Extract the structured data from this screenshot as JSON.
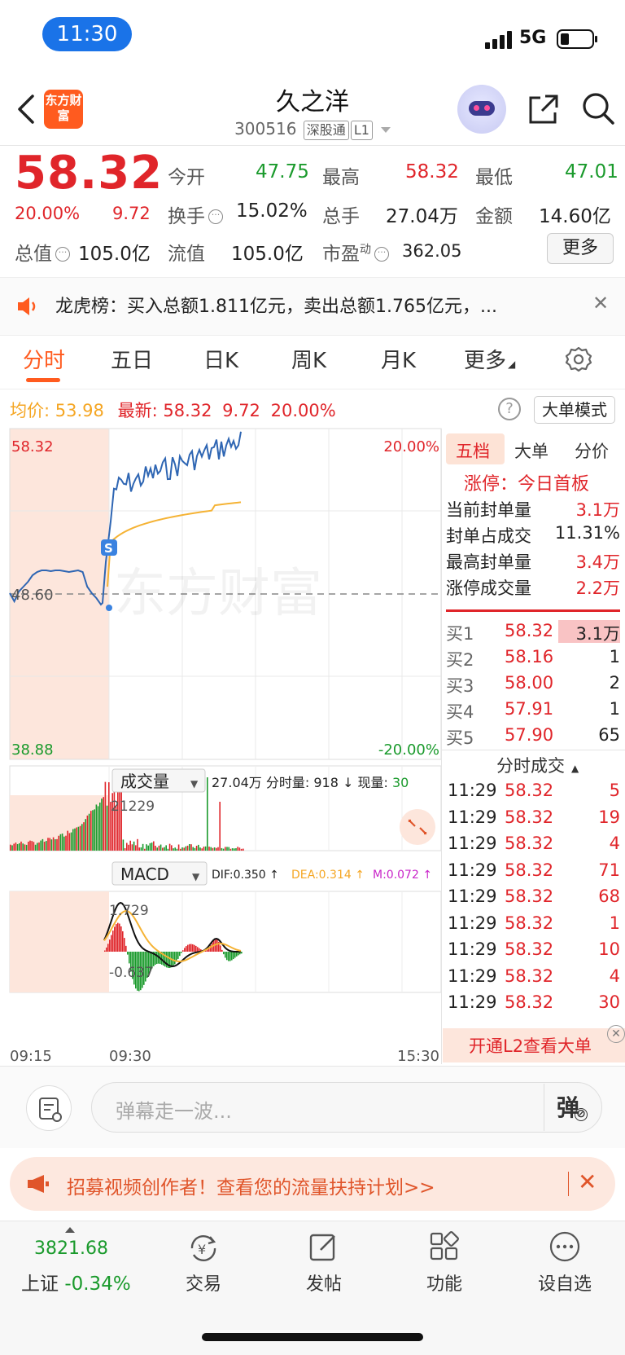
{
  "status_bar": {
    "time": "11:30",
    "network": "5G"
  },
  "header": {
    "logo_text": "东方财富",
    "stock_name": "久之洋",
    "stock_code": "300516",
    "connect_tag": "深股通",
    "level_tag": "L1"
  },
  "quote": {
    "price": "58.32",
    "change_pct": "20.00%",
    "change_amt": "9.72",
    "open_label": "今开",
    "open_value": "47.75",
    "high_label": "最高",
    "high_value": "58.32",
    "low_label": "最低",
    "low_value": "47.01",
    "turnover_label": "换手",
    "turnover_value": "15.02%",
    "volume_label": "总手",
    "volume_value": "27.04万",
    "amount_label": "金额",
    "amount_value": "14.60亿",
    "mktcap_label": "总值",
    "mktcap_value": "105.0亿",
    "float_label": "流值",
    "float_value": "105.0亿",
    "pe_label": "市盈",
    "pe_sup": "动",
    "pe_value": "362.05",
    "more_button": "更多"
  },
  "dragon_tiger": {
    "text": "龙虎榜：买入总额1.811亿元，卖出总额1.765亿元，..."
  },
  "tabs": [
    {
      "label": "分时"
    },
    {
      "label": "五日"
    },
    {
      "label": "日K"
    },
    {
      "label": "周K"
    },
    {
      "label": "月K"
    },
    {
      "label": "更多"
    }
  ],
  "intraday_info": {
    "avg_label": "均价:",
    "avg_value": "53.98",
    "latest_label": "最新:",
    "latest_value": "58.32",
    "latest_chg": "9.72",
    "latest_pct": "20.00%",
    "big_order_button": "大单模式"
  },
  "price_chart": {
    "y_top_label": "58.32",
    "y_mid_label": "48.60",
    "y_bottom_label": "38.88",
    "pct_top_label": "20.00%",
    "pct_bottom_label": "-20.00%",
    "watermark": "东方财富",
    "marker": "S",
    "colors": {
      "price": "#2f66b3",
      "avg": "#f5b335",
      "up": "#e0252a",
      "down": "#1a9a2c"
    }
  },
  "volume_panel": {
    "selector": "成交量",
    "summary": "27.04万 分时量: 918 ↓ 现量: ",
    "current_volume": "30",
    "max_label": "21229"
  },
  "macd_panel": {
    "selector": "MACD",
    "dif": "DIF:0.350 ↑",
    "dea": "DEA:0.314 ↑",
    "m": "M:0.072 ↑",
    "max_label": "1.729",
    "min_label": "-0.637"
  },
  "time_axis": {
    "t1": "09:15",
    "t2": "09:30",
    "t3": "15:30"
  },
  "side_panel": {
    "tabs": [
      "五档",
      "大单",
      "分价"
    ],
    "limit_title": "涨停：今日首板",
    "stats": [
      {
        "label": "当前封单量",
        "value": "3.1万"
      },
      {
        "label": "封单占成交",
        "value": "11.31%"
      },
      {
        "label": "最高封单量",
        "value": "3.4万"
      },
      {
        "label": "涨停成交量",
        "value": "2.2万"
      }
    ],
    "bids": [
      {
        "label": "买1",
        "price": "58.32",
        "volume": "3.1万"
      },
      {
        "label": "买2",
        "price": "58.16",
        "volume": "1"
      },
      {
        "label": "买3",
        "price": "58.00",
        "volume": "2"
      },
      {
        "label": "买4",
        "price": "57.91",
        "volume": "1"
      },
      {
        "label": "买5",
        "price": "57.90",
        "volume": "65"
      }
    ],
    "trades_title": "分时成交",
    "trades": [
      {
        "time": "11:29",
        "price": "58.32",
        "volume": "5"
      },
      {
        "time": "11:29",
        "price": "58.32",
        "volume": "19"
      },
      {
        "time": "11:29",
        "price": "58.32",
        "volume": "4"
      },
      {
        "time": "11:29",
        "price": "58.32",
        "volume": "71"
      },
      {
        "time": "11:29",
        "price": "58.32",
        "volume": "68"
      },
      {
        "time": "11:29",
        "price": "58.32",
        "volume": "1"
      },
      {
        "time": "11:29",
        "price": "58.32",
        "volume": "10"
      },
      {
        "time": "11:29",
        "price": "58.32",
        "volume": "4"
      },
      {
        "time": "11:29",
        "price": "58.32",
        "volume": "30"
      }
    ],
    "l2_banner": "开通L2查看大单"
  },
  "comment_bar": {
    "placeholder": "弹幕走一波...",
    "danmu_button": "弹"
  },
  "promo": {
    "text": "招募视频创作者！查看您的流量扶持计划>>"
  },
  "bottom_nav": {
    "index_value": "3821.68",
    "index_name": "上证",
    "index_change": "-0.34%",
    "items": [
      {
        "label": "交易"
      },
      {
        "label": "发帖"
      },
      {
        "label": "功能"
      },
      {
        "label": "设自选"
      }
    ]
  }
}
